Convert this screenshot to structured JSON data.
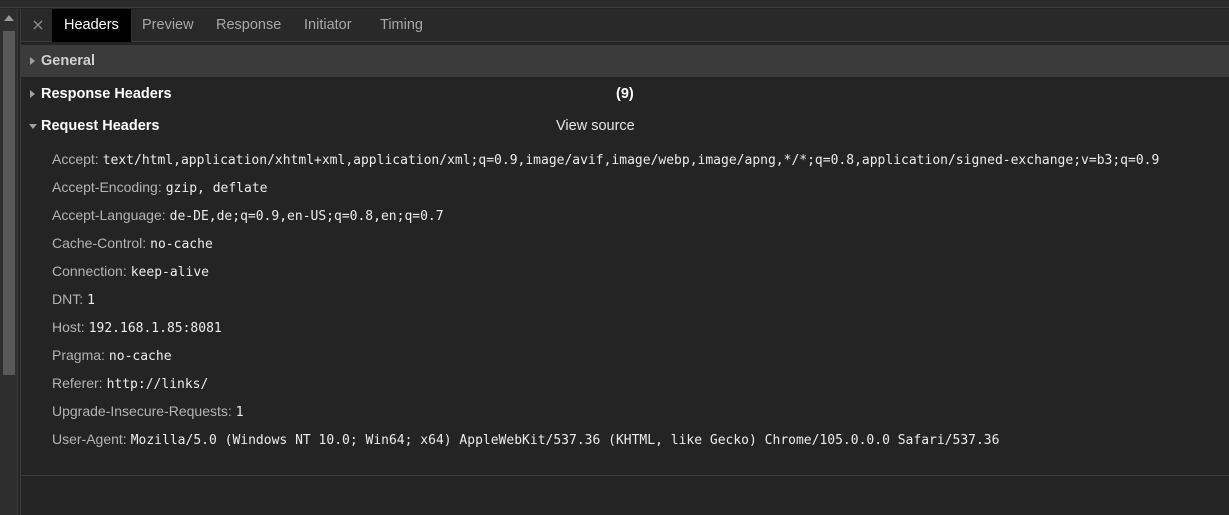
{
  "tabs": [
    {
      "label": "Headers",
      "active": true
    },
    {
      "label": "Preview",
      "active": false
    },
    {
      "label": "Response",
      "active": false
    },
    {
      "label": "Initiator",
      "active": false
    },
    {
      "label": "Timing",
      "active": false
    }
  ],
  "close_icon": "×",
  "sections": {
    "general": {
      "title": "General",
      "expanded": false
    },
    "response": {
      "title": "Response Headers",
      "count": "(9)",
      "expanded": false
    },
    "request": {
      "title": "Request Headers",
      "view_source": "View source",
      "expanded": true
    }
  },
  "request_headers": [
    {
      "name": "Accept:",
      "value": "text/html,application/xhtml+xml,application/xml;q=0.9,image/avif,image/webp,image/apng,*/*;q=0.8,application/signed-exchange;v=b3;q=0.9"
    },
    {
      "name": "Accept-Encoding:",
      "value": "gzip, deflate"
    },
    {
      "name": "Accept-Language:",
      "value": "de-DE,de;q=0.9,en-US;q=0.8,en;q=0.7"
    },
    {
      "name": "Cache-Control:",
      "value": "no-cache"
    },
    {
      "name": "Connection:",
      "value": "keep-alive"
    },
    {
      "name": "DNT:",
      "value": "1"
    },
    {
      "name": "Host:",
      "value": "192.168.1.85:8081"
    },
    {
      "name": "Pragma:",
      "value": "no-cache"
    },
    {
      "name": "Referer:",
      "value": "http://links/"
    },
    {
      "name": "Upgrade-Insecure-Requests:",
      "value": "1"
    },
    {
      "name": "User-Agent:",
      "value": "Mozilla/5.0 (Windows NT 10.0; Win64; x64) AppleWebKit/537.36 (KHTML, like Gecko) Chrome/105.0.0.0 Safari/537.36"
    }
  ]
}
